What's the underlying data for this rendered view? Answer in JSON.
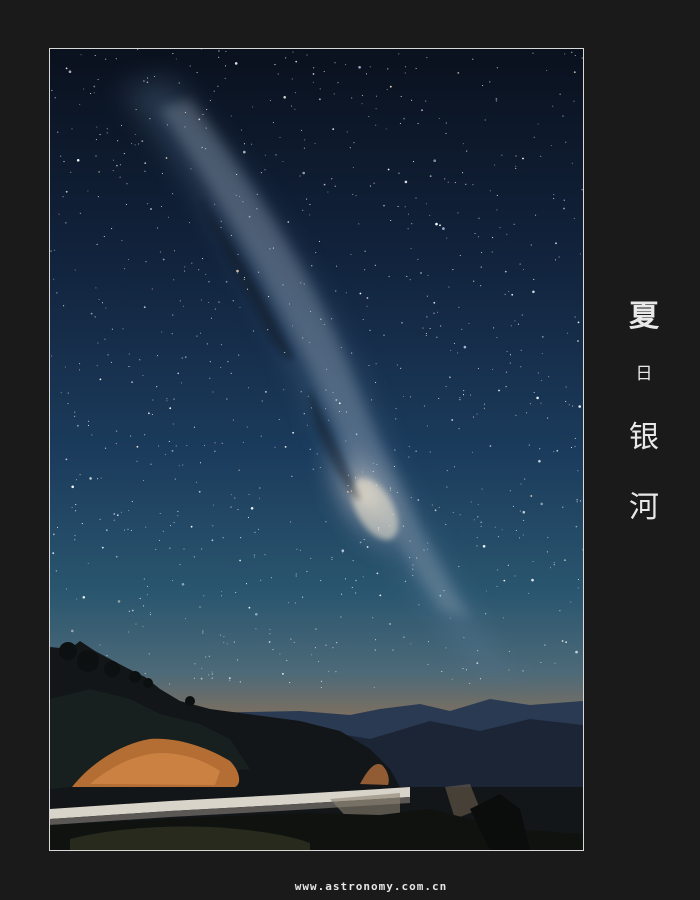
{
  "photo": {
    "subject": "milky-way-night-sky",
    "colors": {
      "sky_top": "#0b1220",
      "sky_mid": "#1f4364",
      "horizon_glow": "#8a6a4e",
      "mountains": "#1b2536",
      "hillside": "#14181a",
      "rock": "#c07a3a",
      "frame_border": "#d8d8d8",
      "background": "#1a1a1a"
    }
  },
  "caption": {
    "chars": [
      "夏",
      "日",
      "银",
      "河"
    ]
  },
  "watermark": {
    "text": "www.astronomy.com.cn"
  }
}
